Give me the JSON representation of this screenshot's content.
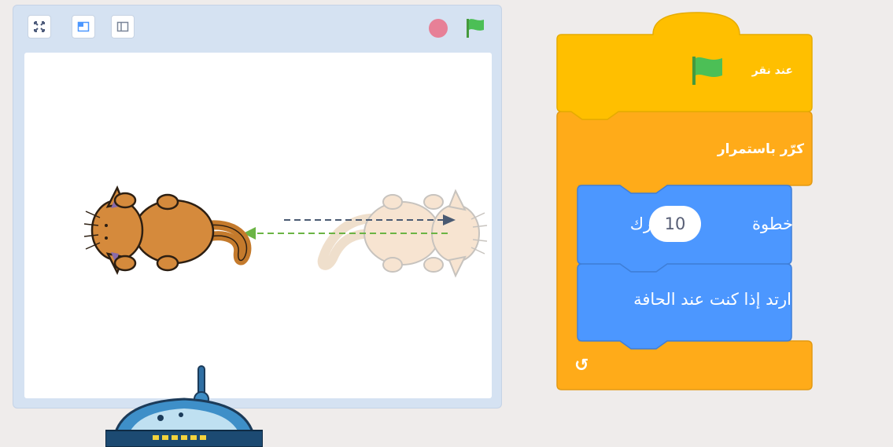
{
  "stage": {
    "toolbar": {
      "fullscreen_icon": "fullscreen-icon",
      "small_stage_icon": "small-stage-layout-icon",
      "large_stage_icon": "large-stage-layout-icon",
      "stop_icon": "stop-icon",
      "green_flag_icon": "green-flag-icon"
    },
    "sprites": [
      "cat-sprite",
      "cat-sprite-ghost"
    ]
  },
  "script": {
    "hat_block": {
      "label": "عند نقر",
      "icon": "green-flag-icon"
    },
    "forever_block": {
      "label": "كرّر باستمرار",
      "loop_icon": "loop-arrow-icon",
      "loop_symbol": "↺"
    },
    "move_block": {
      "label_before": "تحرك",
      "steps": "10",
      "label_after": "خطوة"
    },
    "bounce_block": {
      "label": "ارتد إذا كنت عند الحافة"
    }
  },
  "colors": {
    "control_orange": "#ffab19",
    "events_yellow": "#ffbf00",
    "motion_blue": "#4c97ff",
    "stage_bg": "#d5e2f2",
    "stop_red": "#ec5f78",
    "flag_green": "#4cbf56"
  }
}
